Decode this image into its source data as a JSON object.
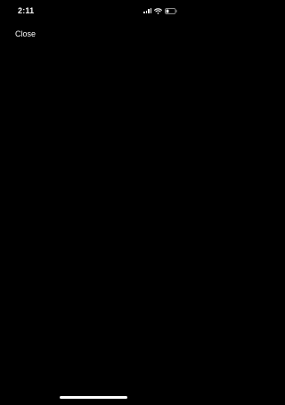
{
  "status_bar": {
    "time": "2:11",
    "icons": [
      "cellular-signal-icon",
      "wifi-icon",
      "battery-icon"
    ],
    "battery_level": 0.3
  },
  "header": {
    "close_label": "Close"
  },
  "colors": {
    "background": "#000000",
    "foreground": "#ffffff"
  }
}
